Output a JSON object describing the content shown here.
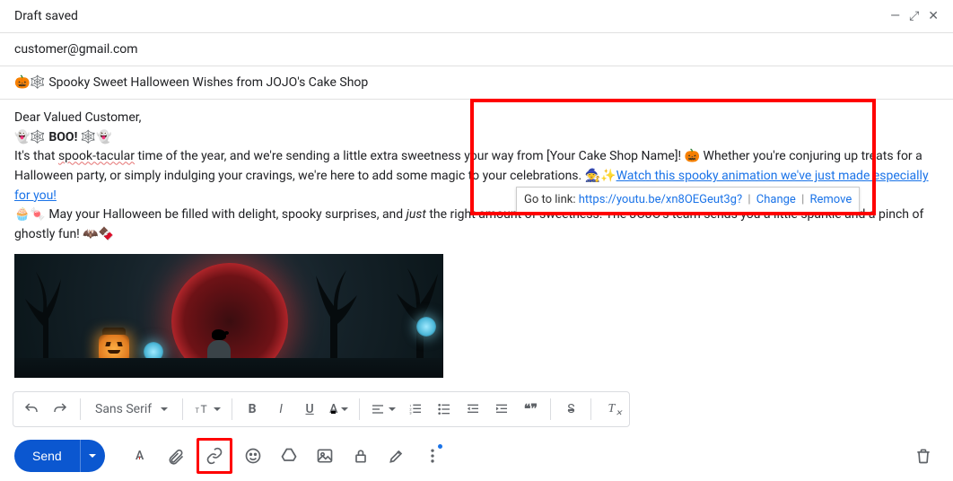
{
  "header": {
    "title": "Draft saved"
  },
  "recipients": "customer@gmail.com",
  "subject": {
    "icons": "🎃🕸️",
    "text": "Spooky Sweet Halloween Wishes from JOJO's Cake Shop"
  },
  "body": {
    "greeting": "Dear Valued Customer,",
    "boo_line_pre": "👻🕸️ ",
    "boo_word": "BOO!",
    "boo_line_post": " 🕸️👻",
    "p1_a": "It's that ",
    "p1_spooky": "spook-tacular",
    "p1_b": " time of the year, and we're sending a little extra sweetness your way from [Your Cake Shop Name]! 🎃 Whether you're conjuring up treats for a Halloween party, or simply indulging your cravings, we're here to add some magic to your celebrations. 🧙✨",
    "link_text": "Watch this spooky animation we've just made especially for you!",
    "p2_a": "🧁🍬 May your Halloween be filled with delight, spooky surprises, and ",
    "p2_just": "just",
    "p2_b": " the right amount of sweetness. The JOJO's team sends you a little sparkle and a pinch of ghostly fun! 🦇🍫"
  },
  "tooltip": {
    "label": "Go to link: ",
    "url": "https://youtu.be/xn8OEGeut3g?",
    "change": "Change",
    "remove": "Remove"
  },
  "format_bar": {
    "font": "Sans Serif",
    "bold": "B",
    "italic": "I",
    "underline": "U",
    "color": "A",
    "quote": "❝❞",
    "strike": "S",
    "tx_1": "T",
    "tx_2": "✕"
  },
  "bottom_bar": {
    "send": "Send"
  }
}
